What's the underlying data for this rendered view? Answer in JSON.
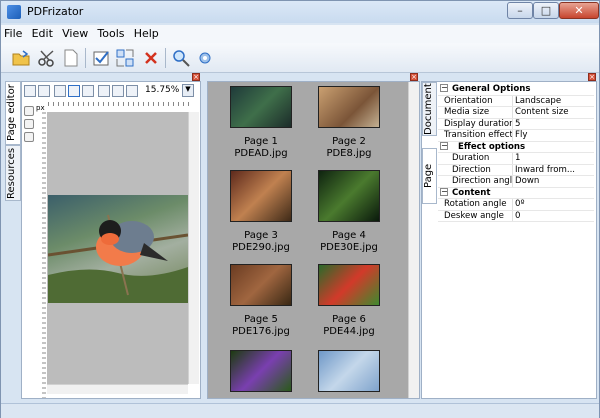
{
  "window": {
    "title": "PDFrizator"
  },
  "menu": [
    "File",
    "Edit",
    "View",
    "Tools",
    "Help"
  ],
  "toolbar_icons": [
    "open-icon",
    "scissors-icon",
    "new-page-icon",
    "check-icon",
    "select-icon",
    "delete-icon",
    "search-icon",
    "settings-icon"
  ],
  "editor": {
    "tabs": [
      "Page editor",
      "Resources"
    ],
    "zoom": "15.75%",
    "ruler_unit": "px"
  },
  "pages": [
    {
      "label": "Page 1",
      "file": "PDEAD.jpg"
    },
    {
      "label": "Page 2",
      "file": "PDE8.jpg"
    },
    {
      "label": "Page 3",
      "file": "PDE290.jpg"
    },
    {
      "label": "Page 4",
      "file": "PDE30E.jpg"
    },
    {
      "label": "Page 5",
      "file": "PDE176.jpg"
    },
    {
      "label": "Page 6",
      "file": "PDE44.jpg"
    }
  ],
  "properties": {
    "tabs": [
      "Document",
      "Page"
    ],
    "general_title": "General Options",
    "orientation_label": "Orientation",
    "orientation_value": "Landscape",
    "media_label": "Media size",
    "media_value": "Content size",
    "display_label": "Display duration",
    "display_value": "5",
    "transition_label": "Transition effect",
    "transition_value": "Fly",
    "effect_title": "Effect options",
    "duration_label": "Duration",
    "duration_value": "1",
    "direction_label": "Direction",
    "direction_value": "Inward from...",
    "dirangle_label": "Direction angle",
    "dirangle_value": "Down",
    "content_title": "Content",
    "rotation_label": "Rotation angle",
    "rotation_value": "0º",
    "deskew_label": "Deskew angle",
    "deskew_value": "0"
  },
  "colors": {
    "close": "#c7452e",
    "canvas": "#bcbcbc",
    "pages_bg": "#a8a8a8"
  }
}
